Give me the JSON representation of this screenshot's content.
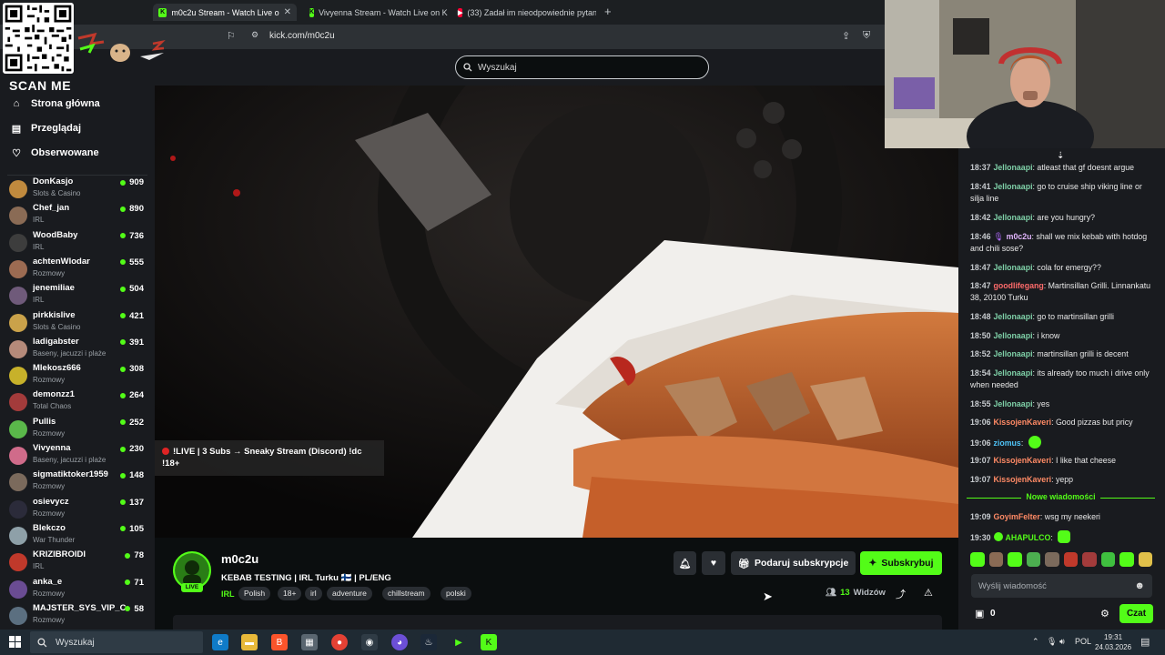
{
  "browser": {
    "tabs": [
      {
        "label": "m0c2u Stream - Watch Live o",
        "favicon": "kick-icon",
        "active": true
      },
      {
        "label": "Vivyenna Stream - Watch Live on Kic",
        "favicon": "kick-icon",
        "active": false
      },
      {
        "label": "(33) Zadał im nieodpowiednie pytani",
        "favicon": "youtube-icon",
        "active": false
      }
    ],
    "url": "kick.com/m0c2u"
  },
  "overlay": {
    "scan_me": "SCAN ME"
  },
  "header": {
    "search_placeholder": "Wyszukaj"
  },
  "sidebar": {
    "nav": [
      {
        "label": "Strona główna",
        "icon": "home-icon"
      },
      {
        "label": "Przeglądaj",
        "icon": "browse-icon"
      },
      {
        "label": "Obserwowane",
        "icon": "heart-icon"
      }
    ],
    "channels": [
      {
        "name": "DonKasjo",
        "category": "Slots & Casino",
        "viewers": "909",
        "color": "#c08a3e"
      },
      {
        "name": "Chef_jan",
        "category": "IRL",
        "viewers": "890",
        "color": "#8a6b55"
      },
      {
        "name": "WoodBaby",
        "category": "IRL",
        "viewers": "736",
        "color": "#3d3d3d"
      },
      {
        "name": "achtenWlodar",
        "category": "Rozmowy",
        "viewers": "555",
        "color": "#9c6b52"
      },
      {
        "name": "jenemiliae",
        "category": "IRL",
        "viewers": "504",
        "color": "#6f5a7a"
      },
      {
        "name": "pirkkislive",
        "category": "Slots & Casino",
        "viewers": "421",
        "color": "#caa24a"
      },
      {
        "name": "ladigabster",
        "category": "Baseny, jacuzzi i plaże",
        "viewers": "391",
        "color": "#b58a7a"
      },
      {
        "name": "Mlekosz666",
        "category": "Rozmowy",
        "viewers": "308",
        "color": "#c7b12a"
      },
      {
        "name": "demonzz1",
        "category": "Total Chaos",
        "viewers": "264",
        "color": "#a33b3b"
      },
      {
        "name": "Pullis",
        "category": "Rozmowy",
        "viewers": "252",
        "color": "#5ab84a"
      },
      {
        "name": "Vivyenna",
        "category": "Baseny, jacuzzi i plaże",
        "viewers": "230",
        "color": "#d06b8a"
      },
      {
        "name": "sigmatiktoker1959",
        "category": "Rozmowy",
        "viewers": "148",
        "color": "#7b6a5c"
      },
      {
        "name": "osievycz",
        "category": "Rozmowy",
        "viewers": "137",
        "color": "#2b2b3a"
      },
      {
        "name": "Blekczo",
        "category": "War Thunder",
        "viewers": "105",
        "color": "#8ea0a8"
      },
      {
        "name": "KRIZIBROIDI",
        "category": "IRL",
        "viewers": "78",
        "color": "#c0392b"
      },
      {
        "name": "anka_e",
        "category": "Rozmowy",
        "viewers": "71",
        "color": "#6a4c93"
      },
      {
        "name": "MAJSTER_SYS_VIP_C",
        "category": "Rozmowy",
        "viewers": "58",
        "color": "#5b6f80"
      }
    ]
  },
  "stream": {
    "overlay_line1": "!LIVE | 3 Subs → Sneaky Stream (Discord) !dc",
    "overlay_line2": "!18+",
    "streamer": "m0c2u",
    "live_badge": "LIVE",
    "title": "KEBAB TESTING | IRL Turku 🇫🇮 | PL/ENG",
    "category": "IRL",
    "tags": [
      "Polish",
      "18+",
      "irl",
      "adventure",
      "chillstream",
      "polski"
    ],
    "gift_label": "Podaruj subskrypcje",
    "subscribe_label": "Subskrybuj",
    "viewer_count": "13",
    "viewers_word": "Widzów"
  },
  "chat": {
    "messages": [
      {
        "time": "18:37",
        "user": "Jellonaapi",
        "color": "#7fd1a8",
        "text": "atleast that gf doesnt argue"
      },
      {
        "time": "18:41",
        "user": "Jellonaapi",
        "color": "#7fd1a8",
        "text": "go to cruise ship viking line or silja line"
      },
      {
        "time": "18:42",
        "user": "Jellonaapi",
        "color": "#7fd1a8",
        "text": "are you hungry?"
      },
      {
        "time": "18:46",
        "user": "m0c2u",
        "color": "#e3b6ff",
        "text": "shall we mix kebab with hotdog and chili sose?"
      },
      {
        "time": "18:47",
        "user": "Jellonaapi",
        "color": "#7fd1a8",
        "text": "cola for emergy??"
      },
      {
        "time": "18:47",
        "user": "goodlifegang",
        "color": "#ff6b6b",
        "text": "Martinsillan Grilli. Linnankatu 38, 20100 Turku"
      },
      {
        "time": "18:48",
        "user": "Jellonaapi",
        "color": "#7fd1a8",
        "text": "go to martinsillan grilli"
      },
      {
        "time": "18:50",
        "user": "Jellonaapi",
        "color": "#7fd1a8",
        "text": "i know"
      },
      {
        "time": "18:52",
        "user": "Jellonaapi",
        "color": "#7fd1a8",
        "text": "martinsillan grilli is decent"
      },
      {
        "time": "18:54",
        "user": "Jellonaapi",
        "color": "#7fd1a8",
        "text": "its already too much i drive only when needed"
      },
      {
        "time": "18:55",
        "user": "Jellonaapi",
        "color": "#7fd1a8",
        "text": "yes"
      },
      {
        "time": "19:06",
        "user": "KissojenKaveri",
        "color": "#ff8a65",
        "text": "Good pizzas but pricy"
      },
      {
        "time": "19:06",
        "user": "ziomus",
        "color": "#4fc3f7",
        "text": ""
      },
      {
        "time": "19:07",
        "user": "KissojenKaveri",
        "color": "#ff8a65",
        "text": "I like that cheese"
      },
      {
        "time": "19:07",
        "user": "KissojenKaveri",
        "color": "#ff8a65",
        "text": "yepp"
      }
    ],
    "new_messages_label": "Nowe wiadomości",
    "new_messages": [
      {
        "time": "19:09",
        "user": "GoyimFelter",
        "color": "#ff8a65",
        "text": "wsg my neekeri"
      },
      {
        "time": "19:30",
        "user": "AHAPULCO",
        "color": "#53fc18",
        "text": ""
      }
    ],
    "input_placeholder": "Wyślij wiadomość",
    "points": "0",
    "send_label": "Czat"
  },
  "taskbar": {
    "search_label": "Wyszukaj",
    "language": "POL",
    "time": "19:31",
    "date": "24.03.2026"
  }
}
